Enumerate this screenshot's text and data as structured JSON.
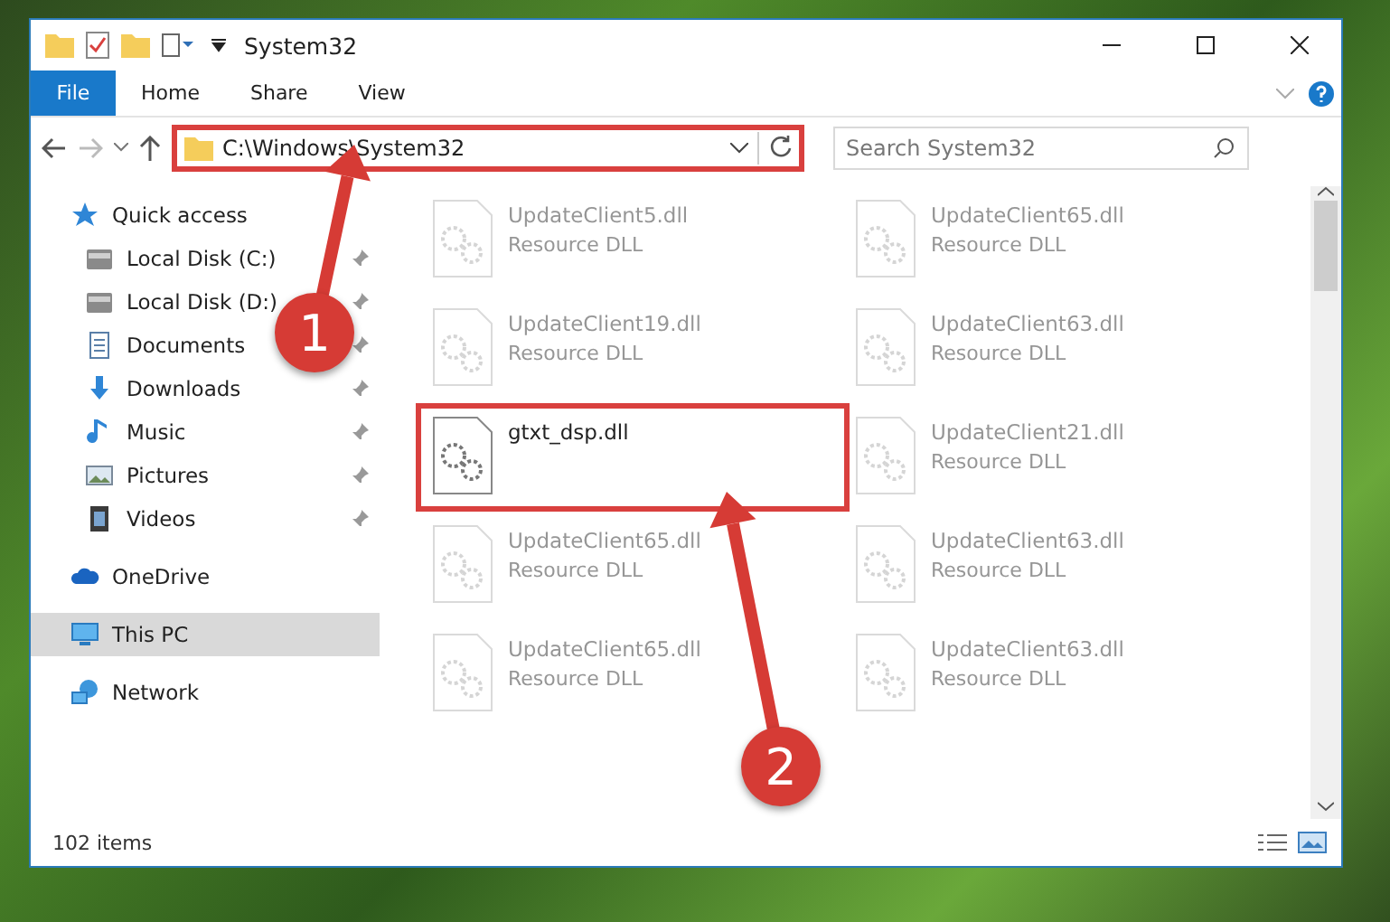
{
  "window": {
    "title": "System32"
  },
  "ribbon_tabs": [
    {
      "label": "File",
      "selected": true
    },
    {
      "label": "Home",
      "selected": false
    },
    {
      "label": "Share",
      "selected": false
    },
    {
      "label": "View",
      "selected": false
    }
  ],
  "address": {
    "path": "C:\\Windows\\System32",
    "annotated": true
  },
  "search": {
    "placeholder": "Search System32"
  },
  "sidebar": {
    "items": [
      {
        "label": "Quick access",
        "kind": "star",
        "selected": false,
        "children": [
          {
            "label": "Local Disk (C:)",
            "kind": "disk",
            "pinned": true
          },
          {
            "label": "Local Disk (D:)",
            "kind": "disk",
            "pinned": true
          },
          {
            "label": "Documents",
            "kind": "doc",
            "pinned": true
          },
          {
            "label": "Downloads",
            "kind": "download",
            "pinned": true
          },
          {
            "label": "Music",
            "kind": "music",
            "pinned": true
          },
          {
            "label": "Pictures",
            "kind": "picture",
            "pinned": true
          },
          {
            "label": "Videos",
            "kind": "video",
            "pinned": true
          }
        ]
      },
      {
        "label": "OneDrive",
        "kind": "cloud",
        "selected": false
      },
      {
        "label": "This PC",
        "kind": "pc",
        "selected": true
      },
      {
        "label": "Network",
        "kind": "network",
        "selected": false
      }
    ]
  },
  "files": [
    {
      "name": "UpdateClient5.dll",
      "type": "Resource DLL",
      "faded": true,
      "annotated": false
    },
    {
      "name": "UpdateClient65.dll",
      "type": "Resource DLL",
      "faded": true,
      "annotated": false
    },
    {
      "name": "UpdateClient19.dll",
      "type": "Resource DLL",
      "faded": true,
      "annotated": false
    },
    {
      "name": "UpdateClient63.dll",
      "type": "Resource DLL",
      "faded": true,
      "annotated": false
    },
    {
      "name": "gtxt_dsp.dll",
      "faded": false,
      "annotated": true
    },
    {
      "name": "UpdateClient21.dll",
      "type": "Resource DLL",
      "faded": true,
      "annotated": false
    },
    {
      "name": "UpdateClient65.dll",
      "type": "Resource DLL",
      "faded": true,
      "annotated": false
    },
    {
      "name": "UpdateClient63.dll",
      "type": "Resource DLL",
      "faded": true,
      "annotated": false
    },
    {
      "name": "UpdateClient65.dll",
      "type": "Resource DLL",
      "faded": true,
      "annotated": false
    },
    {
      "name": "UpdateClient63.dll",
      "type": "Resource DLL",
      "faded": true,
      "annotated": false
    }
  ],
  "status_bar": {
    "count": "102 items"
  },
  "annotations": [
    {
      "label": "1"
    },
    {
      "label": "2"
    }
  ]
}
